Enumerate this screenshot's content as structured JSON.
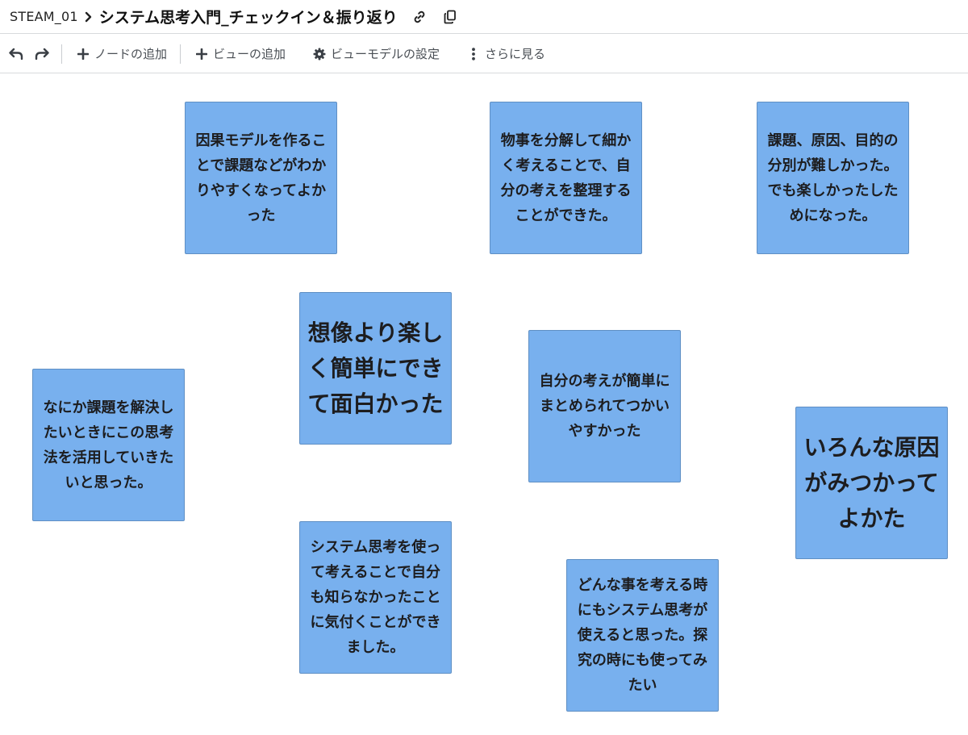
{
  "header": {
    "breadcrumb_root": "STEAM_01",
    "title": "システム思考入門_チェックイン＆振り返り",
    "icons": [
      "chevron-right-icon",
      "link-icon",
      "copy-icon"
    ]
  },
  "toolbar": {
    "add_node_label": "ノードの追加",
    "add_view_label": "ビューの追加",
    "view_model_settings_label": "ビューモデルの設定",
    "more_label": "さらに見る",
    "icons": [
      "undo-icon",
      "redo-icon",
      "plus-icon",
      "plus-icon",
      "gear-icon",
      "more-vertical-icon"
    ]
  },
  "colors": {
    "node_fill": "#78b0ee",
    "node_border": "#5f8fc4",
    "divider": "#d8dadd"
  },
  "nodes": [
    {
      "text": "因果モデルを作ることで課題などがわかりやすくなってよかった"
    },
    {
      "text": "物事を分解して細かく考えることで、自分の考えを整理することができた。"
    },
    {
      "text": "課題、原因、目的の分別が難しかった。でも楽しかったしためになった。"
    },
    {
      "text": "想像より楽しく簡単にできて面白かった"
    },
    {
      "text": "自分の考えが簡単にまとめられてつかいやすかった"
    },
    {
      "text": "なにか課題を解決したいときにこの思考法を活用していきたいと思った。"
    },
    {
      "text": "いろんな原因がみつかってよかた"
    },
    {
      "text": "システム思考を使って考えることで自分も知らなかったことに気付くことができました。"
    },
    {
      "text": "どんな事を考える時にもシステム思考が使えると思った。探究の時にも使ってみたい"
    }
  ]
}
